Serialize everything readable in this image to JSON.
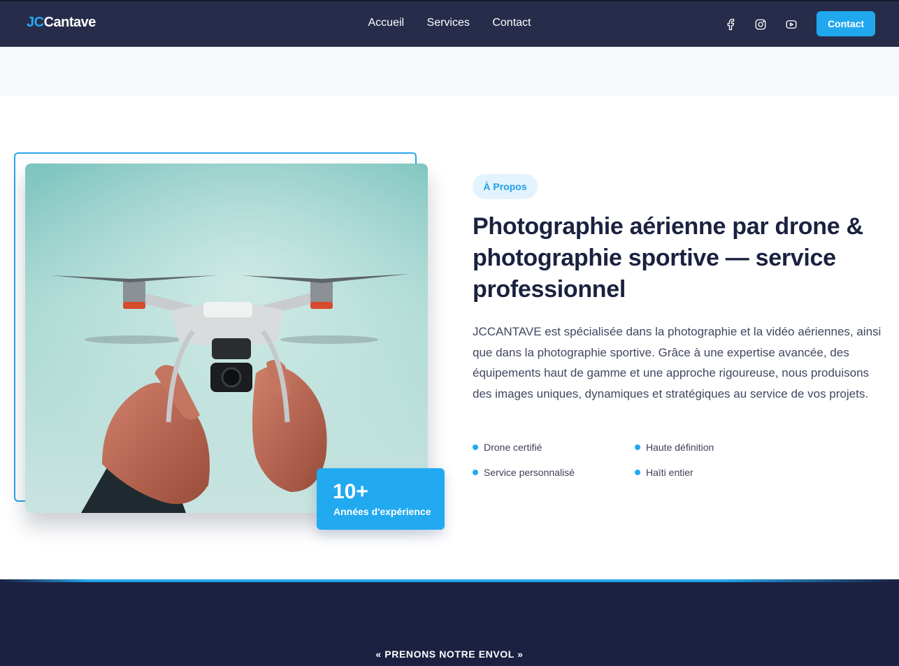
{
  "brand": {
    "logo_prefix": "JC",
    "logo_suffix": "Cantave",
    "accent_color": "#20a8ef",
    "nav_bg": "#262c4a"
  },
  "nav": {
    "links": [
      "Accueil",
      "Services",
      "Contact"
    ],
    "socials": [
      "facebook-icon",
      "instagram-icon",
      "youtube-icon"
    ],
    "cta_label": "Contact"
  },
  "about": {
    "badge": "À Propos",
    "title": "Photographie aérienne par drone & photographie sportive — service professionnel",
    "description": "JCCANTAVE est spécialisée dans la photographie et la vidéo aériennes, ainsi que dans la photographie sportive. Grâce à une expertise avancée, des équipements haut de gamme et une approche rigoureuse, nous produisons des images uniques, dynamiques et stratégiques au service de vos projets.",
    "features": [
      "Drone certifié",
      "Haute définition",
      "Service personnalisé",
      "Haïti entier"
    ],
    "experience": {
      "value": "10+",
      "label": "Années d'expérience"
    },
    "image_subject": "drone-held-by-hands"
  },
  "cta_section": {
    "tagline": "« PRENONS NOTRE ENVOL »",
    "bg_color": "#1c2142"
  }
}
